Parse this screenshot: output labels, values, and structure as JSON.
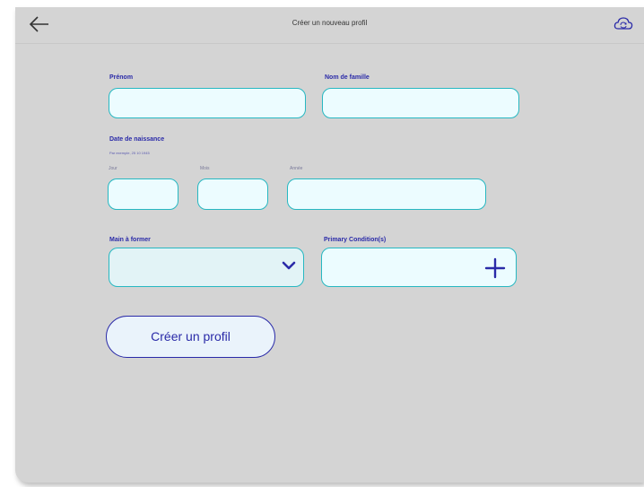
{
  "header": {
    "title": "Créer un nouveau profil",
    "back_icon": "arrow-left-icon",
    "cloud_icon": "cloud-sync-icon"
  },
  "form": {
    "first_name": {
      "label": "Prénom",
      "value": ""
    },
    "last_name": {
      "label": "Nom de famille",
      "value": ""
    },
    "birthdate": {
      "label": "Date de naissance",
      "hint": "Par exemple, 25 10 1945",
      "day_label": "Jour",
      "month_label": "Mois",
      "year_label": "Année"
    },
    "hand": {
      "label": "Main à former",
      "selected": "",
      "icon": "chevron-down-icon"
    },
    "condition": {
      "label": "Primary Condition(s)",
      "icon": "plus-icon"
    },
    "submit_label": "Créer un profil"
  },
  "colors": {
    "background": "#d4d4d4",
    "field_fill": "#ecfcff",
    "field_border": "#27b8c2",
    "accent": "#2a2aa8"
  }
}
